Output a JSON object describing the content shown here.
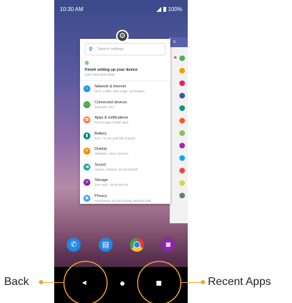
{
  "status_bar": {
    "time": "10:30 AM",
    "battery": "100%"
  },
  "settings": {
    "search_placeholder": "Search settings",
    "finish": {
      "title": "Finish setting up your device",
      "subtitle": "Just a few more steps"
    },
    "items": [
      {
        "title": "Network & internet",
        "subtitle": "Wi-Fi, mobile, data usage, and hotspot",
        "color": "#2196f3",
        "icon": "wifi-icon"
      },
      {
        "title": "Connected devices",
        "subtitle": "Bluetooth, NFC",
        "color": "#43a047",
        "icon": "devices-icon"
      },
      {
        "title": "Apps & notifications",
        "subtitle": "Recent apps, default apps",
        "color": "#ff7043",
        "icon": "apps-icon"
      },
      {
        "title": "Battery",
        "subtitle": "91% - 10 min until fully charged",
        "color": "#00897b",
        "icon": "battery-icon"
      },
      {
        "title": "Display",
        "subtitle": "Wallpaper, sleep, font size",
        "color": "#fb8c00",
        "icon": "display-icon"
      },
      {
        "title": "Sound",
        "subtitle": "Volume, vibration, Do Not Disturb",
        "color": "#26a69a",
        "icon": "sound-icon"
      },
      {
        "title": "Storage",
        "subtitle": "37% used - 20.29 GB free",
        "color": "#8e24aa",
        "icon": "storage-icon"
      },
      {
        "title": "Privacy",
        "subtitle": "Permissions, account activity, personal data",
        "color": "#42a5f5",
        "icon": "privacy-icon"
      }
    ]
  },
  "dock": [
    {
      "icon": "phone-icon",
      "color": "#1e88e5"
    },
    {
      "icon": "messages-icon",
      "color": "#1e88e5"
    },
    {
      "icon": "chrome-icon",
      "color": "#43a047"
    },
    {
      "icon": "camera-icon",
      "color": "#8e24aa"
    }
  ],
  "annotations": {
    "back": "Back",
    "recent": "Recent Apps",
    "color": "#f2a12a"
  }
}
